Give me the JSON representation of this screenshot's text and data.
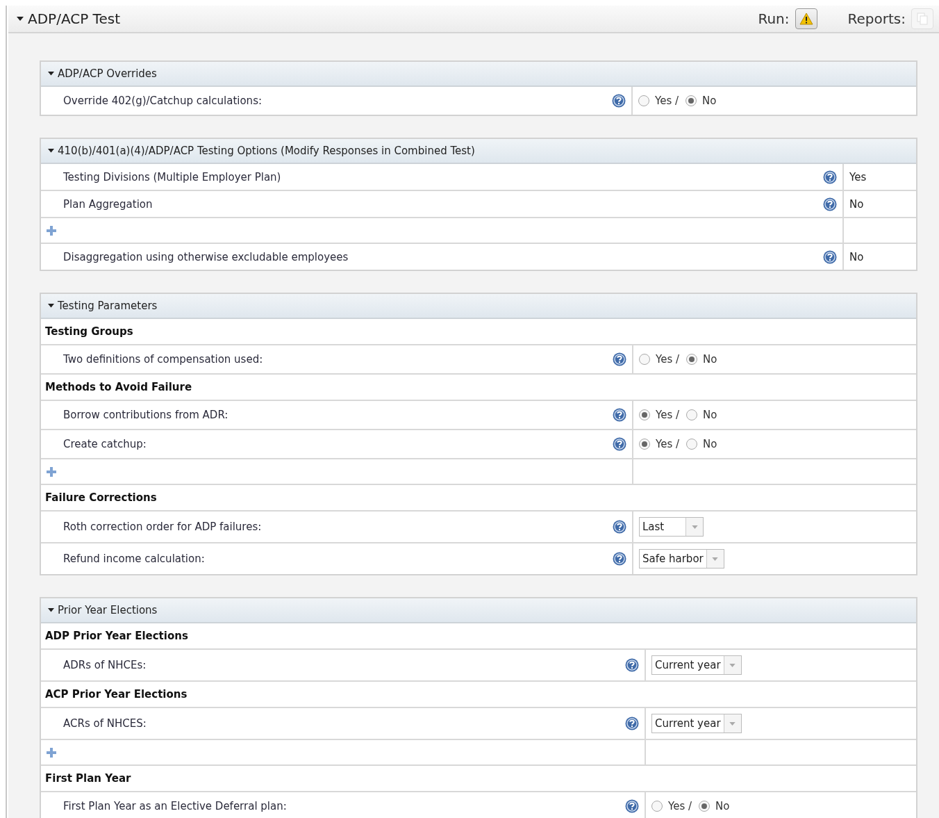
{
  "panel": {
    "title": "ADP/ACP Test",
    "expanded": true,
    "run_label": "Run:",
    "reports_label": "Reports:",
    "reports_disabled": true
  },
  "sections": [
    {
      "title": "ADP/ACP Overrides",
      "expanded": true,
      "rows": [
        {
          "kind": "question",
          "label": "Override 402(g)/Catchup calculations:",
          "control": {
            "kind": "radio",
            "options": [
              {
                "label": "Yes /",
                "selected": false
              },
              {
                "label": "No",
                "selected": true
              }
            ]
          }
        }
      ]
    },
    {
      "title": "410(b)/401(a)(4)/ADP/ACP Testing Options (Modify Responses in Combined Test)",
      "expanded": true,
      "rows": [
        {
          "kind": "question",
          "label": "Testing Divisions (Multiple Employer Plan)",
          "control": {
            "kind": "text",
            "value": "Yes"
          }
        },
        {
          "kind": "question",
          "label": "Plan Aggregation",
          "control": {
            "kind": "text",
            "value": "No"
          }
        },
        {
          "kind": "add"
        },
        {
          "kind": "question",
          "label": "Disaggregation using otherwise excludable employees",
          "control": {
            "kind": "text",
            "value": "No"
          }
        }
      ]
    },
    {
      "title": "Testing Parameters",
      "expanded": true,
      "rows": [
        {
          "kind": "group",
          "label": "Testing Groups"
        },
        {
          "kind": "question",
          "label": "Two definitions of compensation used:",
          "control": {
            "kind": "radio",
            "options": [
              {
                "label": "Yes /",
                "selected": false
              },
              {
                "label": "No",
                "selected": true
              }
            ]
          }
        },
        {
          "kind": "group",
          "label": "Methods to Avoid Failure"
        },
        {
          "kind": "question",
          "label": "Borrow contributions from ADR:",
          "control": {
            "kind": "radio",
            "options": [
              {
                "label": "Yes /",
                "selected": true
              },
              {
                "label": "No",
                "selected": false
              }
            ]
          }
        },
        {
          "kind": "question",
          "label": "Create catchup:",
          "control": {
            "kind": "radio",
            "options": [
              {
                "label": "Yes /",
                "selected": true
              },
              {
                "label": "No",
                "selected": false
              }
            ]
          }
        },
        {
          "kind": "add"
        },
        {
          "kind": "group",
          "label": "Failure Corrections"
        },
        {
          "kind": "question",
          "label": "Roth correction order for ADP failures:",
          "control": {
            "kind": "select",
            "value": "Last"
          }
        },
        {
          "kind": "question",
          "label": "Refund income calculation:",
          "control": {
            "kind": "select",
            "value": "Safe harbor"
          }
        }
      ]
    },
    {
      "title": "Prior Year Elections",
      "expanded": true,
      "rows": [
        {
          "kind": "group",
          "label": "ADP Prior Year Elections"
        },
        {
          "kind": "question",
          "label": "ADRs of NHCEs:",
          "control": {
            "kind": "select",
            "value": "Current year"
          }
        },
        {
          "kind": "group",
          "label": "ACP Prior Year Elections"
        },
        {
          "kind": "question",
          "label": "ACRs of NHCES:",
          "control": {
            "kind": "select",
            "value": "Current year"
          }
        },
        {
          "kind": "add"
        },
        {
          "kind": "group",
          "label": "First Plan Year"
        },
        {
          "kind": "question",
          "label": "First Plan Year as an Elective Deferral plan:",
          "control": {
            "kind": "radio",
            "options": [
              {
                "label": "Yes /",
                "selected": false
              },
              {
                "label": "No",
                "selected": true
              }
            ]
          }
        }
      ]
    }
  ]
}
